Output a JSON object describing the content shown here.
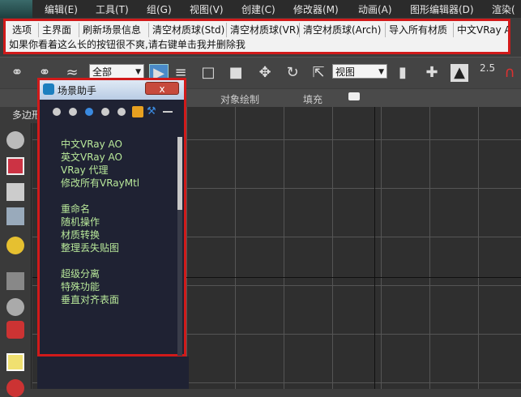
{
  "menubar": {
    "items": [
      "编辑(E)",
      "工具(T)",
      "组(G)",
      "视图(V)",
      "创建(C)",
      "修改器(M)",
      "动画(A)",
      "图形编辑器(D)",
      "渲染("
    ]
  },
  "scriptbar": {
    "buttons": [
      "选项",
      "主界面",
      "刷新场景信息",
      "清空材质球(Std)",
      "清空材质球(VR)",
      "清空材质球(Arch)",
      "导入所有材质",
      "中文VRay AO"
    ],
    "hint": "如果你看着这么长的按钮很不爽,请右键单击我并删除我"
  },
  "toolbar": {
    "filter_select": "全部",
    "view_select": "视图",
    "snap_value": "2.5"
  },
  "ribbon": {
    "tabs": [
      "对象绘制",
      "填充"
    ],
    "left_label": "多边形"
  },
  "dialog": {
    "title": "场景助手",
    "close_label": "x",
    "groups": [
      [
        "中文VRay AO",
        "英文VRay AO",
        "VRay 代理",
        "修改所有VRayMtl"
      ],
      [
        "重命名",
        "随机操作",
        "材质转换",
        "整理丢失贴图"
      ],
      [
        "超级分离",
        "特殊功能",
        "垂直对齐表面"
      ]
    ]
  },
  "colors": {
    "highlight_border": "#d11a1a",
    "dialog_bg": "#1f2233",
    "dialog_text": "#b8e89a"
  }
}
